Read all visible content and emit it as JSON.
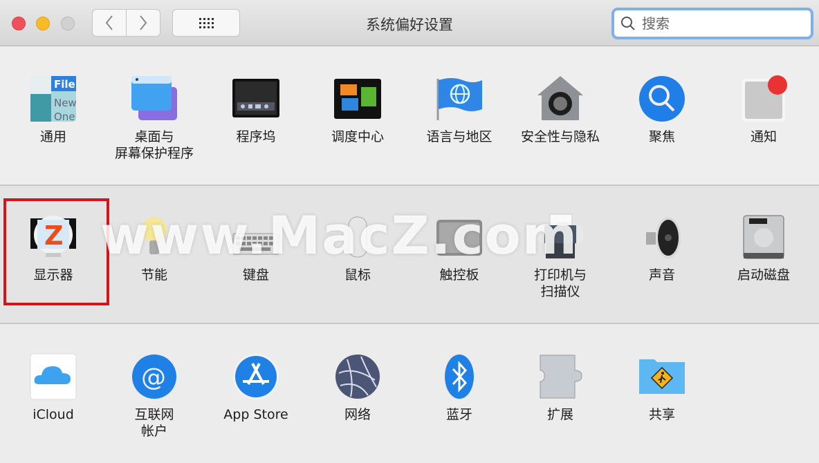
{
  "window": {
    "title": "系统偏好设置",
    "traffic_lights": {
      "close": "#f0505a",
      "minimize": "#f8bb28",
      "maximize": "#d1d1d1"
    },
    "back_icon": "chevron-left-icon",
    "forward_icon": "chevron-right-icon",
    "show_all_icon": "grid-icon"
  },
  "search": {
    "placeholder": "搜索",
    "value": ""
  },
  "sections": [
    {
      "items": [
        {
          "label": "通用",
          "icon": "general-icon"
        },
        {
          "label": "桌面与\n屏幕保护程序",
          "icon": "desktop-screensaver-icon"
        },
        {
          "label": "程序坞",
          "icon": "dock-icon"
        },
        {
          "label": "调度中心",
          "icon": "mission-control-icon"
        },
        {
          "label": "语言与地区",
          "icon": "language-region-icon"
        },
        {
          "label": "安全性与隐私",
          "icon": "security-privacy-icon"
        },
        {
          "label": "聚焦",
          "icon": "spotlight-icon"
        },
        {
          "label": "通知",
          "icon": "notifications-icon"
        }
      ]
    },
    {
      "items": [
        {
          "label": "显示器",
          "icon": "displays-icon"
        },
        {
          "label": "节能",
          "icon": "energy-saver-icon"
        },
        {
          "label": "键盘",
          "icon": "keyboard-icon"
        },
        {
          "label": "鼠标",
          "icon": "mouse-icon"
        },
        {
          "label": "触控板",
          "icon": "trackpad-icon"
        },
        {
          "label": "打印机与\n扫描仪",
          "icon": "printers-scanners-icon"
        },
        {
          "label": "声音",
          "icon": "sound-icon"
        },
        {
          "label": "启动磁盘",
          "icon": "startup-disk-icon"
        }
      ]
    },
    {
      "items": [
        {
          "label": "iCloud",
          "icon": "icloud-icon"
        },
        {
          "label": "互联网\n帐户",
          "icon": "internet-accounts-icon"
        },
        {
          "label": "App Store",
          "icon": "app-store-icon"
        },
        {
          "label": "网络",
          "icon": "network-icon"
        },
        {
          "label": "蓝牙",
          "icon": "bluetooth-icon"
        },
        {
          "label": "扩展",
          "icon": "extensions-icon"
        },
        {
          "label": "共享",
          "icon": "sharing-icon"
        }
      ]
    }
  ],
  "highlight": {
    "target": "显示器",
    "color": "#d4141b"
  },
  "watermark": "www.MacZ.com"
}
